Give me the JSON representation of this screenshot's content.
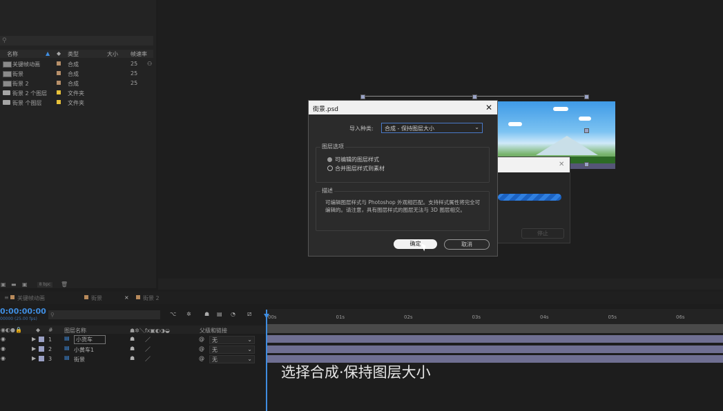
{
  "project": {
    "header": {
      "name": "名称",
      "type": "类型",
      "size": "大小",
      "fps": "帧速率"
    },
    "items": [
      {
        "name": "关键帧动画",
        "type": "合成",
        "fps": "25",
        "color": "#b8906a",
        "kind": "comp"
      },
      {
        "name": "街景",
        "type": "合成",
        "fps": "25",
        "color": "#b8906a",
        "kind": "comp"
      },
      {
        "name": "街景 2",
        "type": "合成",
        "fps": "25",
        "color": "#b8906a",
        "kind": "comp"
      },
      {
        "name": "街景 2 个图层",
        "type": "文件夹",
        "fps": "",
        "color": "#e8c23a",
        "kind": "folder"
      },
      {
        "name": "街景 个图层",
        "type": "文件夹",
        "fps": "",
        "color": "#e8c23a",
        "kind": "folder"
      }
    ],
    "bpc": "8 bpc"
  },
  "dialog": {
    "title": "街景.psd",
    "import_kind_label": "导入种类:",
    "import_kind_value": "合成 - 保持图层大小",
    "layer_options_label": "图层选项",
    "option1": "可编辑的图层样式",
    "option2": "合并图层样式到素材",
    "selected_option": "option1",
    "description_label": "描述",
    "description": "可编辑图层样式与 Photoshop 外观相匹配。支持样式属性将完全可编辑的。请注意，具有图层样式的图层无法与 3D 图层相交。",
    "ok": "确定",
    "cancel": "取消"
  },
  "progress_dialog": {
    "stop": "停止"
  },
  "timeline": {
    "tabs": [
      "关键帧动画",
      "街景",
      "街景 2"
    ],
    "timecode": "0:00:00:00",
    "timecode_sub": "00000 (25.00 fps)",
    "header": {
      "num": "#",
      "layer_name": "图层名称",
      "parent": "父级和链接"
    },
    "layers": [
      {
        "num": "1",
        "name": "小货车",
        "parent": "无"
      },
      {
        "num": "2",
        "name": "小黄车1",
        "parent": "无"
      },
      {
        "num": "3",
        "name": "街景",
        "parent": "无"
      }
    ],
    "ruler": [
      "00s",
      "01s",
      "02s",
      "03s",
      "04s",
      "05s",
      "06s"
    ]
  },
  "caption": "选择合成·保持图层大小"
}
